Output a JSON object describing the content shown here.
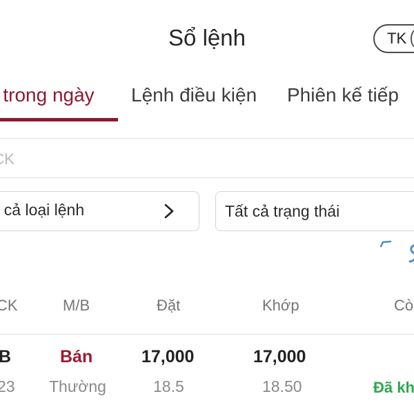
{
  "header": {
    "title": "Sổ lệnh",
    "account_button_label": "TK"
  },
  "tabs": [
    {
      "label": "h trong ngày",
      "active": true
    },
    {
      "label": "Lệnh điều kiện",
      "active": false
    },
    {
      "label": "Phiên kế tiếp",
      "active": false
    }
  ],
  "search": {
    "placeholder": "ã CK",
    "value": ""
  },
  "filters": {
    "order_type": "t cả loại lệnh",
    "status": "Tất cả trạng thái"
  },
  "table": {
    "headers": [
      "CK",
      "M/B",
      "Đặt",
      "Khớp",
      "Cò"
    ],
    "rows": [
      {
        "symbol": "B",
        "symbol_sub": "23",
        "side": "Bán",
        "order_kind": "Thường",
        "order_price": "17,000",
        "order_qty": "18.5",
        "match_price": "17,000",
        "match_qty": "18.50",
        "status": "Đã kh"
      }
    ]
  },
  "colors": {
    "accent": "#8c1a2e",
    "sell": "#9b1b30",
    "status_green": "#2ea84f",
    "spinner": "#4a90c8"
  }
}
